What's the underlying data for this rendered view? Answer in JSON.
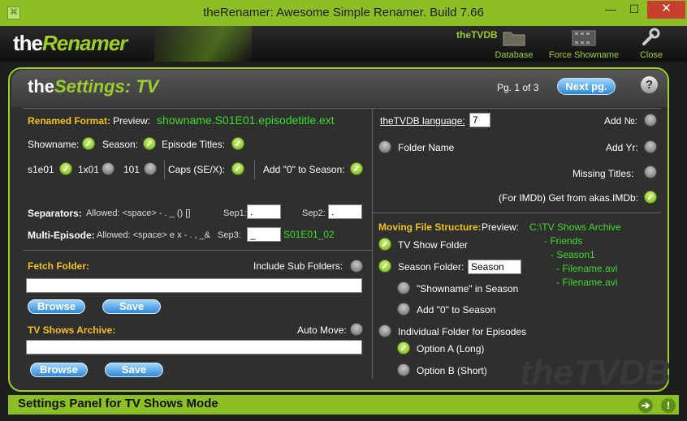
{
  "window": {
    "title": "theRenamer: Awesome Simple Renamer. Build 7.66",
    "minimize": "—",
    "maximize": "☐",
    "close": "✕"
  },
  "header": {
    "logo_bold": "the",
    "logo_italic": "Renamer",
    "tvdb": "theTVDB",
    "database": "Database",
    "force": "Force Showname",
    "close": "Close"
  },
  "panel": {
    "title_bold": "the",
    "title_italic": "Settings: TV",
    "page": "Pg. 1 of 3",
    "next": "Next pg.",
    "help": "?"
  },
  "rename": {
    "label": "Renamed Format:",
    "preview_label": "Preview:",
    "preview": "showname.S01E01.episodetitle.ext",
    "showname": "Showname:",
    "season": "Season:",
    "episode_titles": "Episode Titles:",
    "s1e01": "s1e01",
    "x1x01": "1x01",
    "n101": "101",
    "caps": "Caps (SE/X):",
    "add0": "Add \"0\" to Season:"
  },
  "separators": {
    "label": "Separators:",
    "allowed": "Allowed: <space> - . _ () []",
    "sep1_label": "Sep1:",
    "sep1": ".",
    "sep2_label": "Sep2:",
    "sep2": ".",
    "multi_label": "Multi-Episode:",
    "multi_allowed": "Allowed: <space> e x - . , _&",
    "sep3_label": "Sep3:",
    "sep3": "_",
    "multi_preview": "S01E01_02"
  },
  "fetch": {
    "label": "Fetch Folder:",
    "include": "Include Sub Folders:",
    "value": "",
    "browse": "Browse",
    "save": "Save"
  },
  "archive": {
    "label": "TV Shows Archive:",
    "auto": "Auto Move:",
    "value": "",
    "browse": "Browse",
    "save": "Save"
  },
  "tvdb": {
    "lang_label": "theTVDB language:",
    "lang": "7",
    "add_no": "Add №:",
    "folder_name": "Folder Name",
    "add_yr": "Add Yr:",
    "missing": "Missing Titles:",
    "akas": "(For IMDb) Get from akas.IMDb:"
  },
  "moving": {
    "label": "Moving File Structure:",
    "preview_label": "Preview:",
    "p1": "C:\\TV Shows Archive",
    "p2": "- Friends",
    "p3": "- Season1",
    "p4": "- Filename.avi",
    "p5": "- Filename.avi",
    "show_folder": "TV Show Folder",
    "season_folder": "Season Folder:",
    "season_value": "Season",
    "showname_in": "\"Showname\" in Season",
    "add0": "Add \"0\" to  Season",
    "individual": "Individual Folder for Episodes",
    "optA": "Option A (Long)",
    "optB": "Option B (Short)"
  },
  "status": {
    "text": "Settings Panel for TV Shows Mode",
    "arrow": "➔",
    "alert": "!"
  },
  "watermark": "theTVDB"
}
